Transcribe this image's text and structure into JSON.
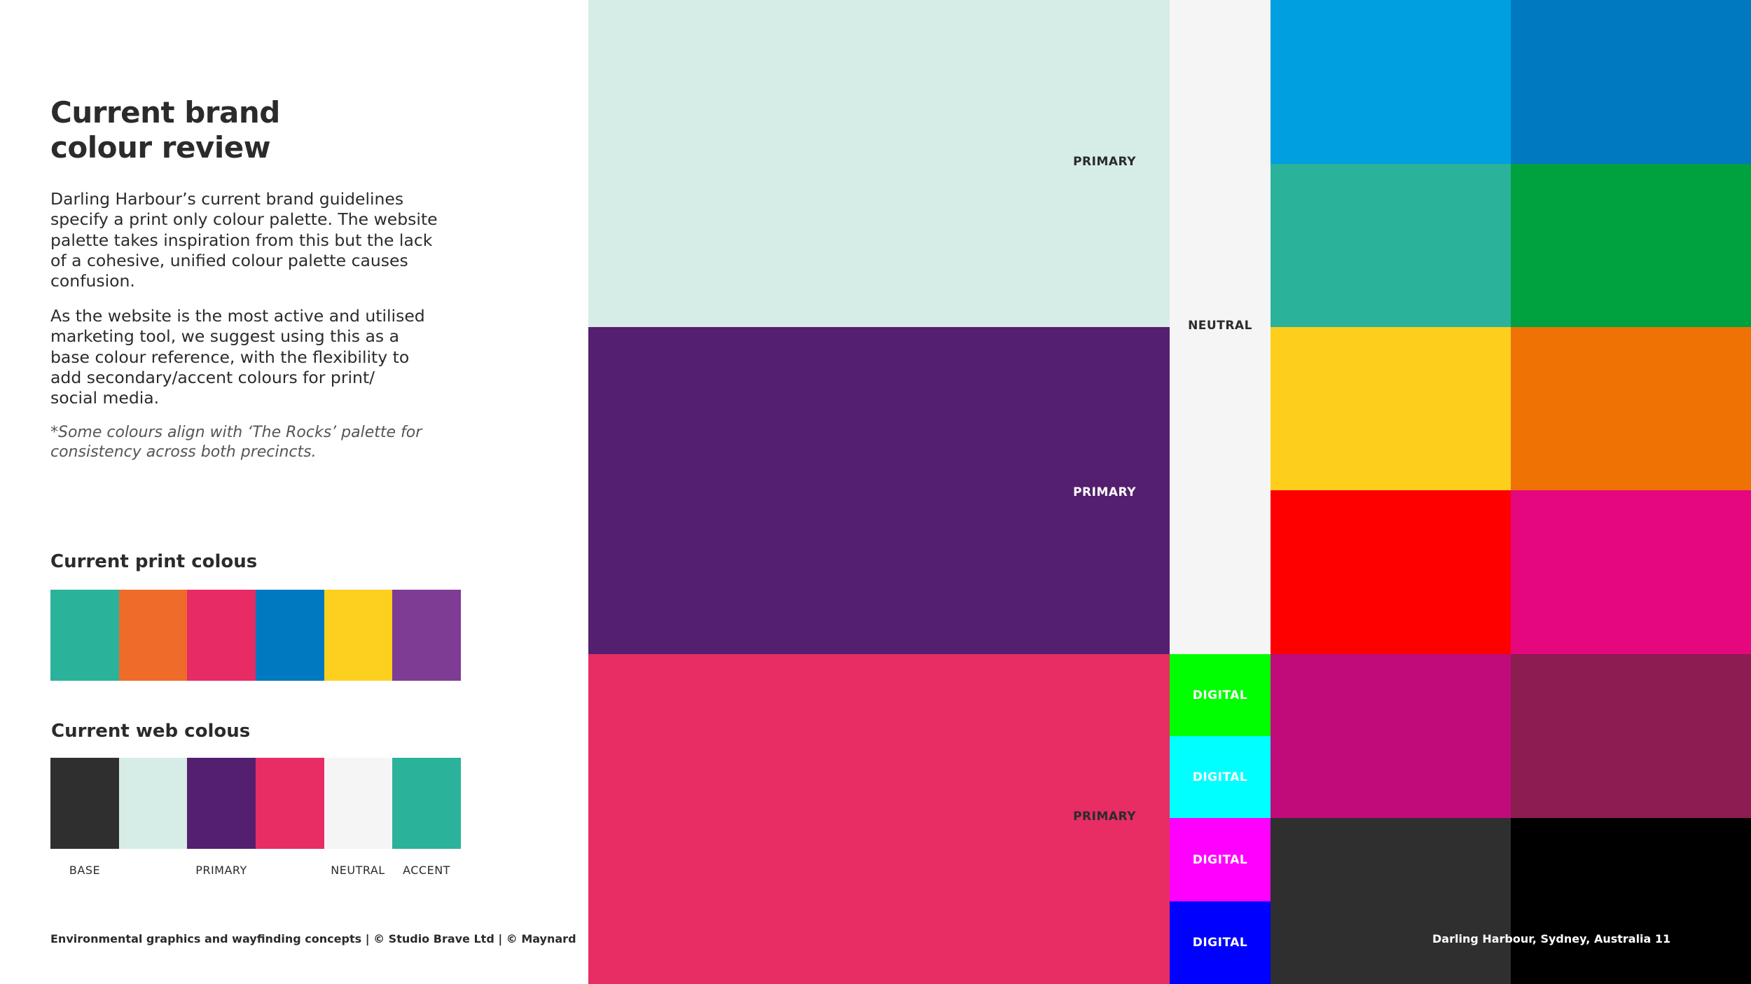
{
  "heading": {
    "line1": "Current brand",
    "line2": "colour review"
  },
  "paragraph1": [
    "Darling Harbour’s current brand guidelines",
    "specify a print only colour palette. The website",
    "palette takes inspiration from this but the lack",
    "of a cohesive, unified colour palette causes",
    "confusion."
  ],
  "paragraph2": [
    "As the website is the most active and utilised",
    "marketing tool, we suggest using this as a",
    "base colour reference, with the flexibility to",
    "add secondary/accent colours for print/",
    "social media."
  ],
  "note": [
    "*Some colours align with ‘The Rocks’ palette for",
    "consistency across both precincts."
  ],
  "print_palette": {
    "title": "Current print colous",
    "colors": [
      "#2bb29a",
      "#ef6b2a",
      "#e72b64",
      "#0079c1",
      "#fdd020",
      "#7e3c94"
    ]
  },
  "web_palette": {
    "title": "Current web colous",
    "colors": [
      "#2f2f2f",
      "#d5ede6",
      "#541f6f",
      "#e72d64",
      "#f5f5f5",
      "#2bb29a"
    ],
    "labels": {
      "base": "BASE",
      "primary": "PRIMARY",
      "neutral": "NEUTRAL",
      "accent": "ACCENT"
    }
  },
  "footer": {
    "left": "Environmental graphics and wayfinding concepts  | © Studio Brave Ltd |  © Maynard",
    "right": "Darling Harbour, Sydney, Australia   11"
  },
  "primary_blocks": [
    {
      "label": "PRIMARY",
      "color": "#d5ede6",
      "label_color": "#2b2b2b"
    },
    {
      "label": "PRIMARY",
      "color": "#541f6f",
      "label_color": "#ffffff"
    },
    {
      "label": "PRIMARY",
      "color": "#e72d64",
      "label_color": "#2b2b2b"
    }
  ],
  "neutral_block": {
    "label": "NEUTRAL",
    "color": "#f5f5f5",
    "label_color": "#2b2b2b"
  },
  "digital_blocks": [
    {
      "label": "DIGITAL",
      "color": "#00ff00"
    },
    {
      "label": "DIGITAL",
      "color": "#00ffff"
    },
    {
      "label": "DIGITAL",
      "color": "#ff00ff"
    },
    {
      "label": "DIGITAL",
      "color": "#0000ff"
    }
  ],
  "accent_grid": [
    [
      "#009fe0",
      "#0079c1"
    ],
    [
      "#2bb29a",
      "#00a13f"
    ],
    [
      "#fdce1c",
      "#ef7204"
    ],
    [
      "#ff0000",
      "#e5077e"
    ],
    [
      "#c10b7a",
      "#8c1c52"
    ],
    [
      "#2f2f2f",
      "#000000"
    ]
  ]
}
